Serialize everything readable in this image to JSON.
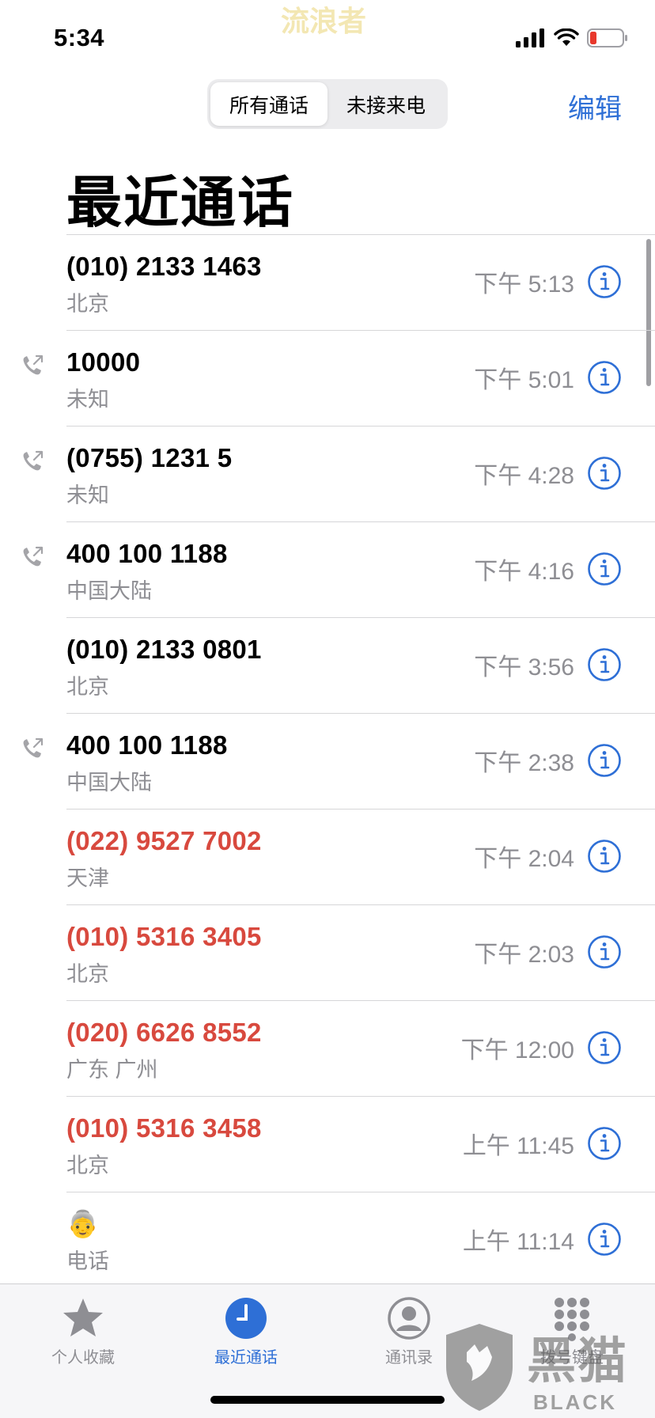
{
  "status_bar": {
    "time": "5:34",
    "watermark": "流浪者"
  },
  "header": {
    "segments": [
      {
        "label": "所有通话",
        "active": true
      },
      {
        "label": "未接来电",
        "active": false
      }
    ],
    "edit_label": "编辑"
  },
  "title": "最近通话",
  "calls": [
    {
      "name": "(010) 2133 1463",
      "subtitle": "北京",
      "time": "下午 5:13",
      "missed": false,
      "outgoing": false
    },
    {
      "name": "10000",
      "subtitle": "未知",
      "time": "下午 5:01",
      "missed": false,
      "outgoing": true
    },
    {
      "name": "(0755) 1231 5",
      "subtitle": "未知",
      "time": "下午 4:28",
      "missed": false,
      "outgoing": true
    },
    {
      "name": "400 100 1188",
      "subtitle": "中国大陆",
      "time": "下午 4:16",
      "missed": false,
      "outgoing": true
    },
    {
      "name": "(010) 2133 0801",
      "subtitle": "北京",
      "time": "下午 3:56",
      "missed": false,
      "outgoing": false
    },
    {
      "name": "400 100 1188",
      "subtitle": "中国大陆",
      "time": "下午 2:38",
      "missed": false,
      "outgoing": true
    },
    {
      "name": "(022) 9527 7002",
      "subtitle": "天津",
      "time": "下午 2:04",
      "missed": true,
      "outgoing": false
    },
    {
      "name": "(010) 5316 3405",
      "subtitle": "北京",
      "time": "下午 2:03",
      "missed": true,
      "outgoing": false
    },
    {
      "name": "(020) 6626 8552",
      "subtitle": "广东 广州",
      "time": "下午 12:00",
      "missed": true,
      "outgoing": false
    },
    {
      "name": "(010) 5316 3458",
      "subtitle": "北京",
      "time": "上午 11:45",
      "missed": true,
      "outgoing": false
    },
    {
      "name": "👵",
      "subtitle": "电话",
      "time": "上午 11:14",
      "missed": false,
      "outgoing": false
    }
  ],
  "tab_bar": {
    "tabs": [
      {
        "label": "个人收藏",
        "icon": "star-icon",
        "active": false
      },
      {
        "label": "最近通话",
        "icon": "clock-icon",
        "active": true
      },
      {
        "label": "通讯录",
        "icon": "contacts-icon",
        "active": false
      },
      {
        "label": "拨号键盘",
        "icon": "keypad-icon",
        "active": false
      }
    ]
  },
  "watermark_logo": {
    "cn": "黑猫",
    "en": "BLACK CAT"
  },
  "colors": {
    "accent": "#2e6fd6",
    "missed": "#d8493e",
    "secondary_text": "#8e8e93"
  }
}
